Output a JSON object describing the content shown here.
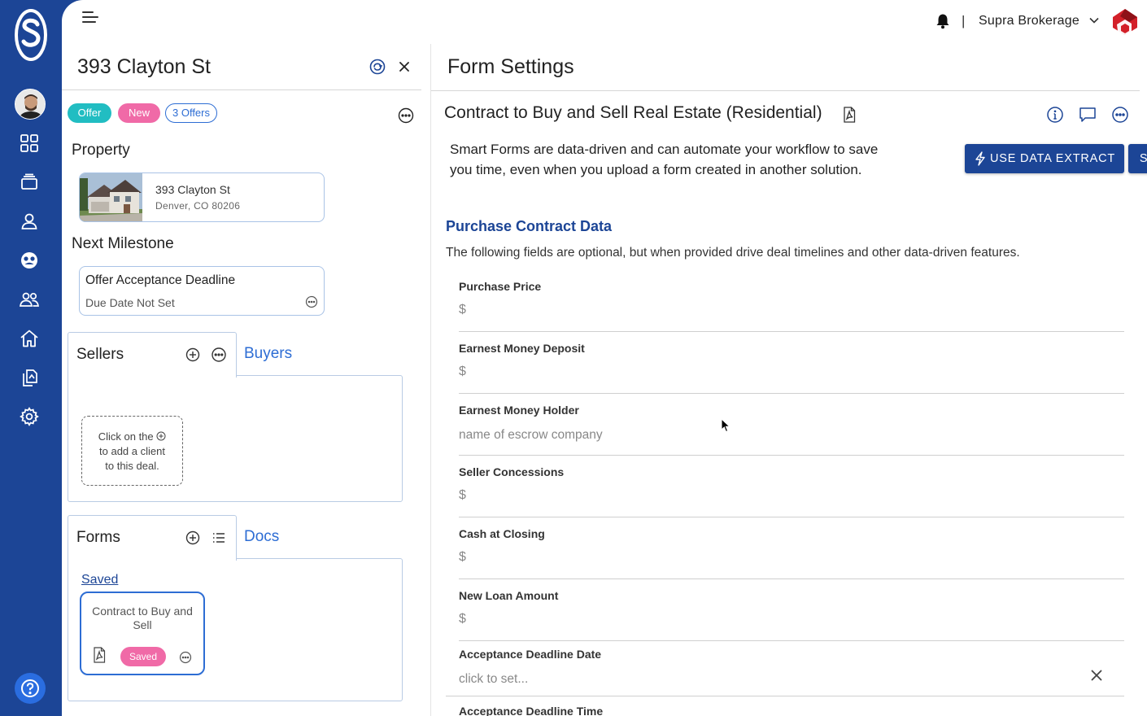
{
  "sidebar": {
    "logo_icon": "supra-logo-icon",
    "items": [
      {
        "name": "dashboard-icon"
      },
      {
        "name": "inbox-icon"
      },
      {
        "name": "contacts-icon"
      },
      {
        "name": "support-icon"
      },
      {
        "name": "team-icon"
      },
      {
        "name": "home-icon"
      },
      {
        "name": "documents-icon"
      },
      {
        "name": "settings-icon"
      }
    ],
    "help_icon": "help-icon"
  },
  "topbar": {
    "separator": "|",
    "brokerage": "Supra Brokerage"
  },
  "deal": {
    "title": "393 Clayton St",
    "chips": {
      "offer": "Offer",
      "new": "New",
      "offers": "3 Offers"
    },
    "property_heading": "Property",
    "property": {
      "name": "393 Clayton St",
      "city": "Denver,  CO  80206"
    },
    "milestone_heading": "Next Milestone",
    "milestone": {
      "title": "Offer Acceptance Deadline",
      "due": "Due Date Not Set"
    },
    "sellers_tab": "Sellers",
    "buyers_tab": "Buyers",
    "client_hint": {
      "line1": "Click on the",
      "line2": "to add a client",
      "line3": "to this deal."
    },
    "forms_tab": "Forms",
    "docs_tab": "Docs",
    "saved_link": "Saved",
    "form_card": {
      "title": "Contract to Buy and Sell",
      "status": "Saved"
    }
  },
  "form_settings": {
    "title": "Form Settings",
    "form_name": "Contract to Buy and Sell Real Estate (Residential)",
    "intro": "Smart Forms are data-driven and can automate your workflow to save you time, even when you upload a form created in another solution.",
    "use_data_extract": "USE DATA EXTRACT",
    "skip": "SKIP",
    "section_title": "Purchase Contract Data",
    "section_desc": "The following fields are optional, but when provided drive deal timelines and other data-driven features.",
    "fields": [
      {
        "label": "Purchase Price",
        "value": "$"
      },
      {
        "label": "Earnest Money Deposit",
        "value": "$"
      },
      {
        "label": "Earnest Money Holder",
        "value": "name of escrow company"
      },
      {
        "label": "Seller Concessions",
        "value": "$"
      },
      {
        "label": "Cash at Closing",
        "value": "$"
      },
      {
        "label": "New Loan Amount",
        "value": "$"
      },
      {
        "label": "Acceptance Deadline Date",
        "value": "click to set..."
      },
      {
        "label": "Acceptance Deadline Time",
        "value": ""
      }
    ]
  },
  "colors": {
    "brand_blue": "#1c4596",
    "teal": "#21bdc2",
    "pink": "#f06aa7",
    "link_blue": "#2d6dd4"
  }
}
